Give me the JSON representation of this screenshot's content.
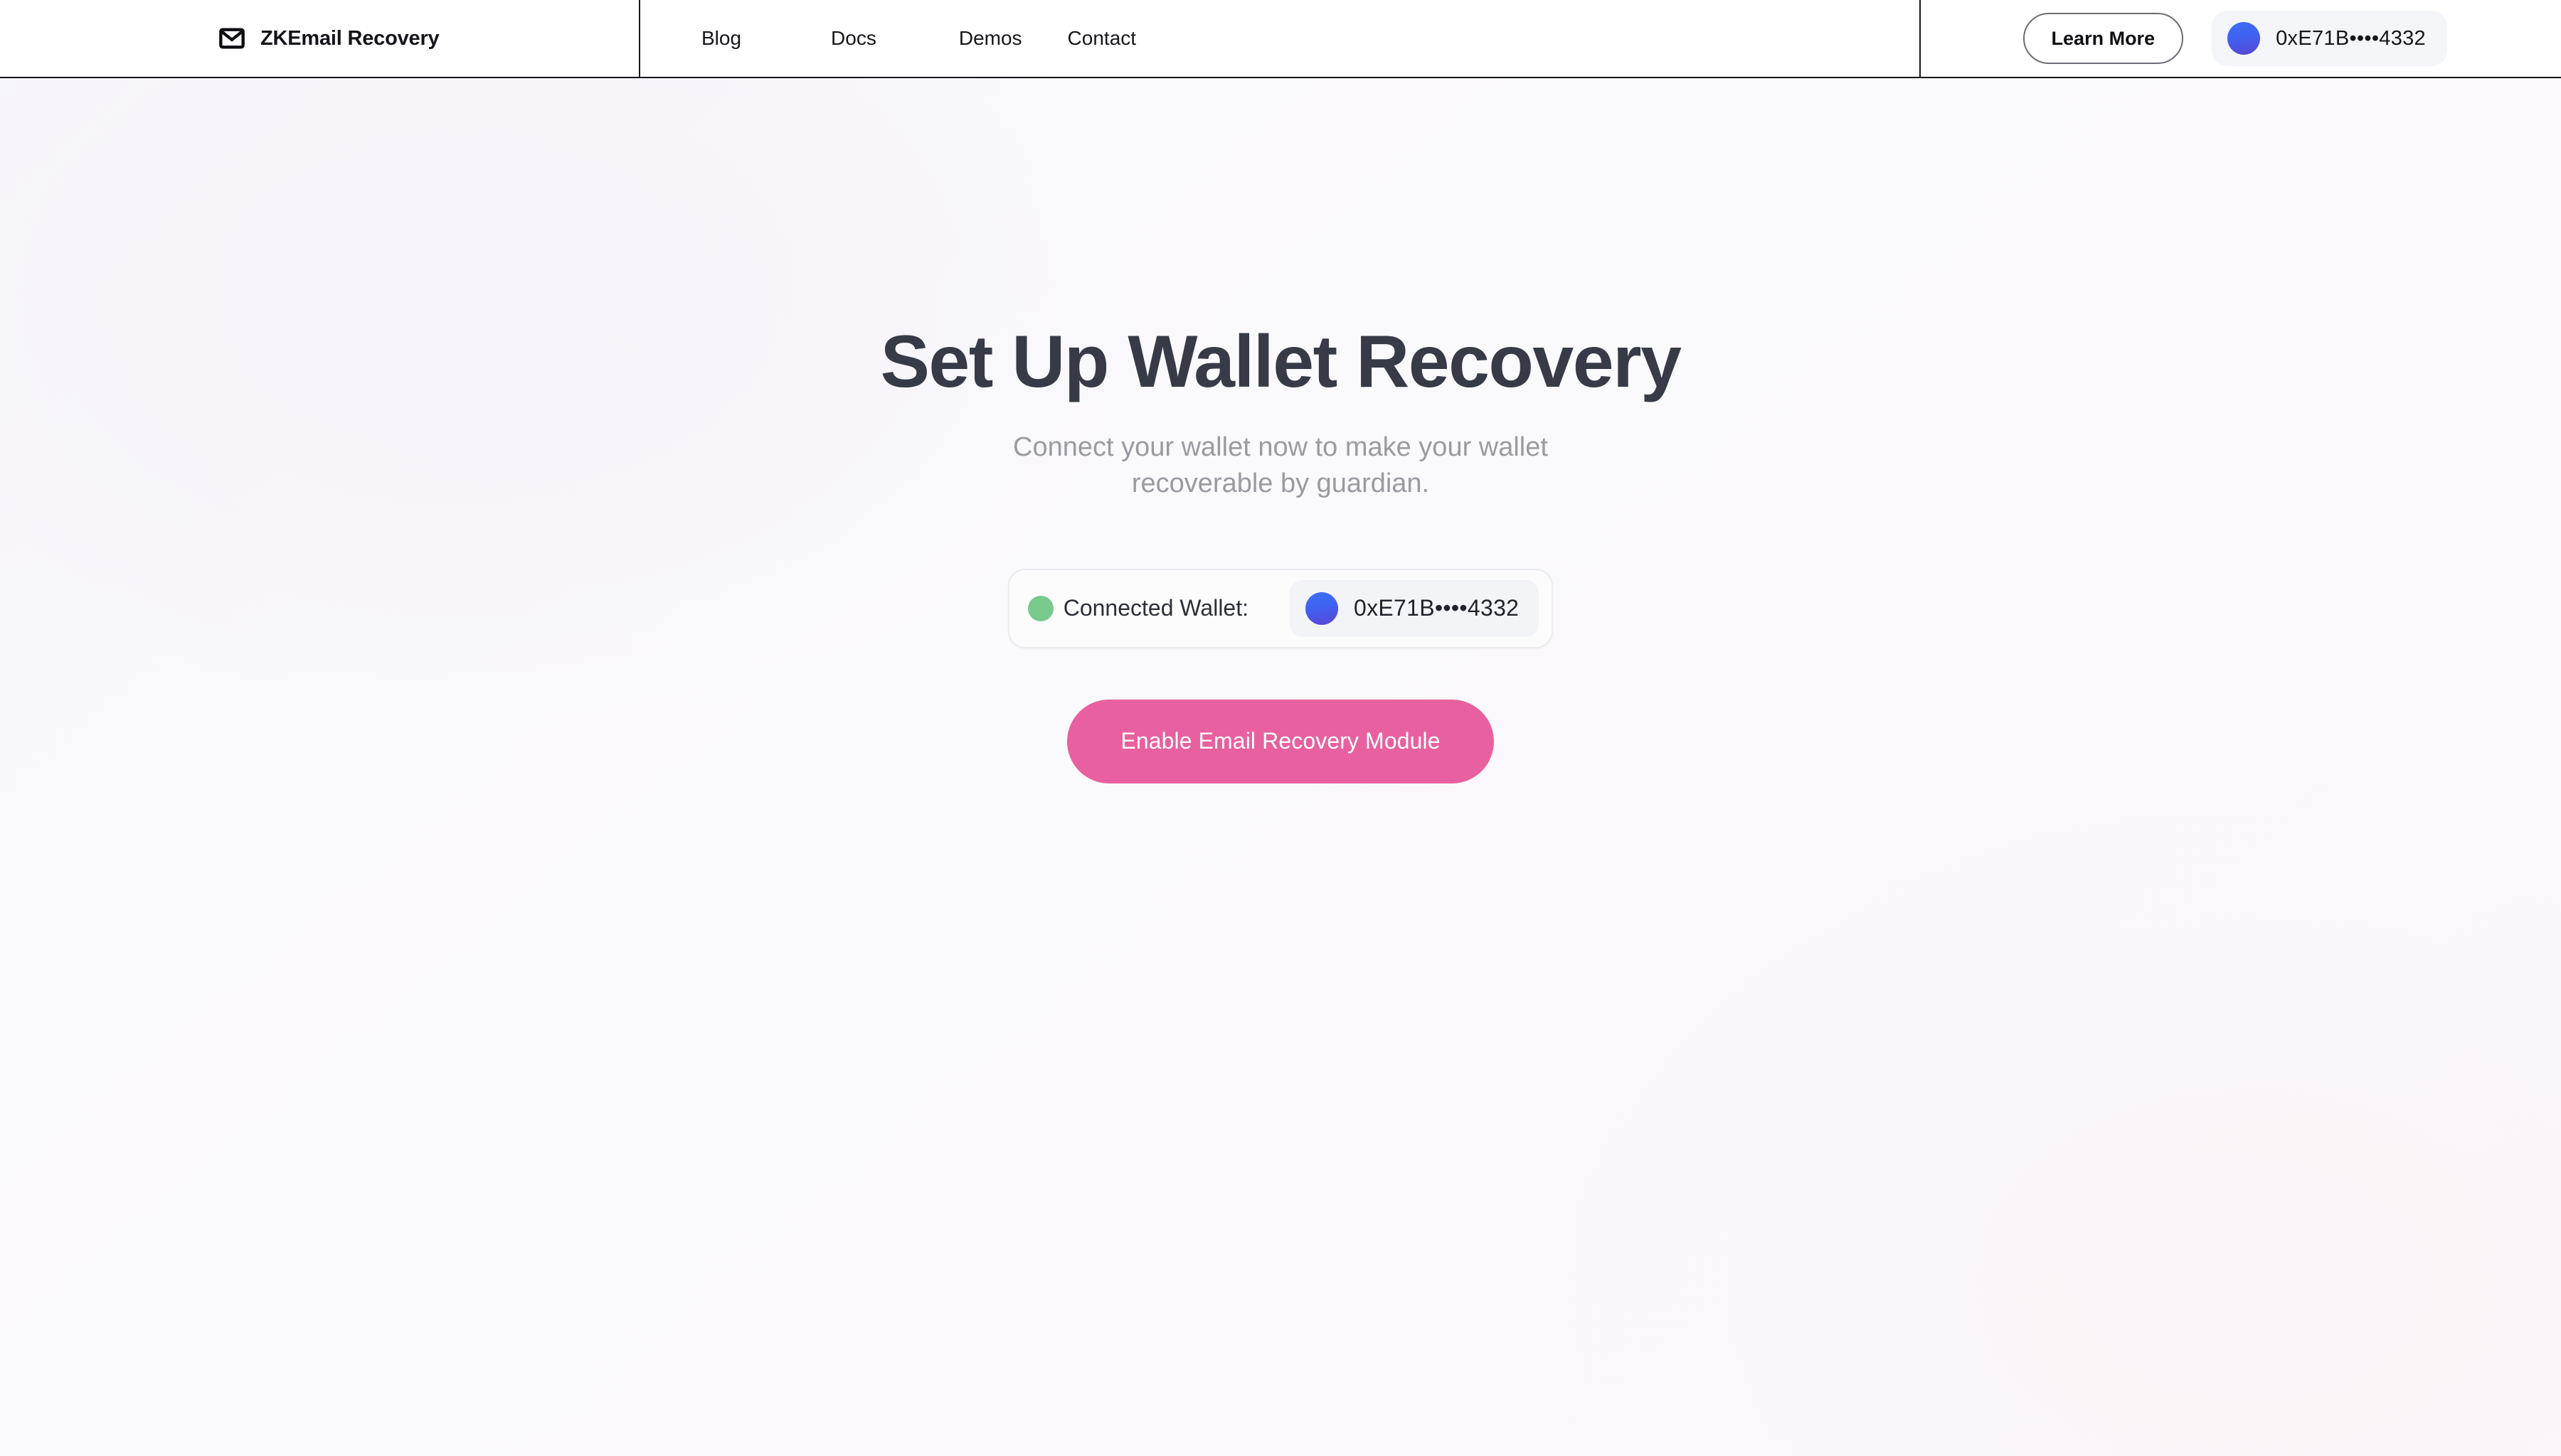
{
  "header": {
    "brand": {
      "icon": "envelope-icon",
      "name": "ZKEmail Recovery"
    },
    "nav": [
      {
        "label": "Blog"
      },
      {
        "label": "Docs"
      },
      {
        "label": "Demos"
      },
      {
        "label": "Contact"
      }
    ],
    "learn_more_label": "Learn More",
    "wallet": {
      "address": "0xE71B••••4332",
      "avatar_icon": "wallet-avatar-icon",
      "avatar_gradient_from": "#3d6ef6",
      "avatar_gradient_to": "#5a45d6"
    }
  },
  "main": {
    "title": "Set Up Wallet Recovery",
    "subtitle": "Connect your wallet now to make your wallet recoverable by guardian.",
    "wallet_card": {
      "status_label": "Connected Wallet:",
      "status_color": "#77ca8c",
      "address": "0xE71B••••4332"
    },
    "cta_label": "Enable Email Recovery Module",
    "cta_color": "#e8609f"
  },
  "theme": {
    "background": "#f8f7fb",
    "title_color": "#363b47",
    "subtitle_color": "#9a9aa2",
    "header_border_color": "#16161a"
  }
}
